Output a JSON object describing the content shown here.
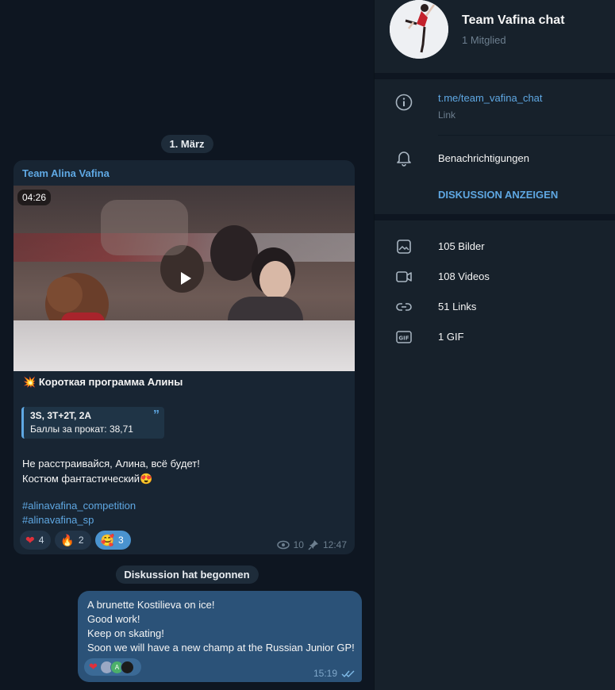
{
  "colors": {
    "chat_bg": "#0e1621",
    "panel_bg": "#17212b",
    "incoming_bubble": "#182533",
    "outgoing_bubble": "#2b5278",
    "accent": "#5fa8e3"
  },
  "chat": {
    "date_separator": "1. März",
    "channel_post": {
      "author": "Team Alina Vafina",
      "video": {
        "duration": "04:26",
        "icon": "play-icon"
      },
      "caption_emoji": "💥",
      "caption": "Короткая программа Алины",
      "quote": {
        "line1": "3S, 3T+2T, 2A",
        "line2": "Баллы за прокат: 38,71",
        "icon": "quote-icon"
      },
      "body_line1": "Не расстраивайся, Алина, всё будет!",
      "body_line2": "Костюм фантастический",
      "body_line2_emoji": "😍",
      "hashtags": [
        "#alinavafina_competition",
        "#alinavafina_sp"
      ],
      "reactions": [
        {
          "emoji": "❤",
          "count": "4"
        },
        {
          "emoji": "🔥",
          "count": "2"
        },
        {
          "emoji": "🥰",
          "count": "3",
          "active": true
        }
      ],
      "views": "10",
      "time": "12:47"
    },
    "service_message": "Diskussion hat begonnen",
    "outgoing_message": {
      "lines": [
        "A brunette Kostilieva on ice!",
        "Good work!",
        "Keep on skating!",
        "Soon we will have a new champ at the Russian Junior GP!"
      ],
      "reaction_emoji": "❤",
      "reaction_avatar_letter": "A",
      "time": "15:19"
    }
  },
  "info_panel": {
    "title": "Team Vafina chat",
    "members": "1 Mitglied",
    "link": "t.me/team_vafina_chat",
    "link_label": "Link",
    "notifications_label": "Benachrichtigungen",
    "discussion_button": "DISKUSSION ANZEIGEN",
    "media": [
      {
        "icon": "image-icon",
        "label": "105 Bilder"
      },
      {
        "icon": "video-icon",
        "label": "108 Videos"
      },
      {
        "icon": "link-icon",
        "label": "51 Links"
      },
      {
        "icon": "gif-icon",
        "label": "1 GIF"
      }
    ]
  }
}
